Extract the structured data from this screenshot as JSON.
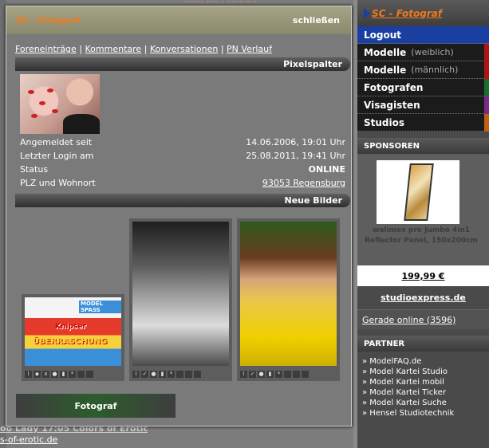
{
  "background": {
    "top_text": "........ ..... . ............",
    "left_text_1": "oo Lady 17:05 Colors of Erotic",
    "left_text_2": "s-of-erotic.de"
  },
  "sidebar": {
    "brand": "SC - Fotograf",
    "nav": [
      {
        "label": "Logout",
        "sub": ""
      },
      {
        "label": "Modelle",
        "sub": "(weiblich)",
        "color": "#b01414"
      },
      {
        "label": "Modelle",
        "sub": "(männlich)",
        "color": "#b01414"
      },
      {
        "label": "Fotografen",
        "sub": "",
        "color": "#1b6e2a"
      },
      {
        "label": "Visagisten",
        "sub": "",
        "color": "#7a2a8a"
      },
      {
        "label": "Studios",
        "sub": "",
        "color": "#c06010"
      }
    ],
    "sponsors_title": "SPONSOREN",
    "sponsor_caption": "walimex pro Jumbo 4in1 Reflector Panel, 150x200cm",
    "sponsor_price": "199,99 €",
    "sponsor_link": "studioexpress.de",
    "online": "Gerade online (3596)",
    "partner_title": "PARTNER",
    "partners": [
      "» ModelFAQ.de",
      "» Model Kartei Studio",
      "» Model Kartei mobil",
      "» Model Kartei Ticker",
      "» Model Kartei Suche",
      "» Hensel Studiotechnik"
    ]
  },
  "modal": {
    "title": "SC - Fotograf",
    "close_label": "schließen",
    "links": [
      "Foreneinträge",
      "Kommentare",
      "Konversationen",
      "PN Verlauf"
    ],
    "section_pixel": "Pixelspalter",
    "section_bilder": "Neue Bilder",
    "info": {
      "member_since_label": "Angemeldet seit",
      "member_since_value": "14.06.2006, 19:01 Uhr",
      "last_login_label": "Letzter Login am",
      "last_login_value": "25.08.2011, 19:41 Uhr",
      "status_label": "Status",
      "status_value": "ONLINE",
      "plz_label": "PLZ und Wohnort",
      "plz_value": "93053 Regensburg"
    },
    "thumb1_overlay_top": "MODEL SPASS",
    "thumb1_overlay_mid": "Knipser",
    "thumb1_overlay_bottom": "ÜBERRASCHUNG",
    "footer_button": "Fotograf"
  }
}
